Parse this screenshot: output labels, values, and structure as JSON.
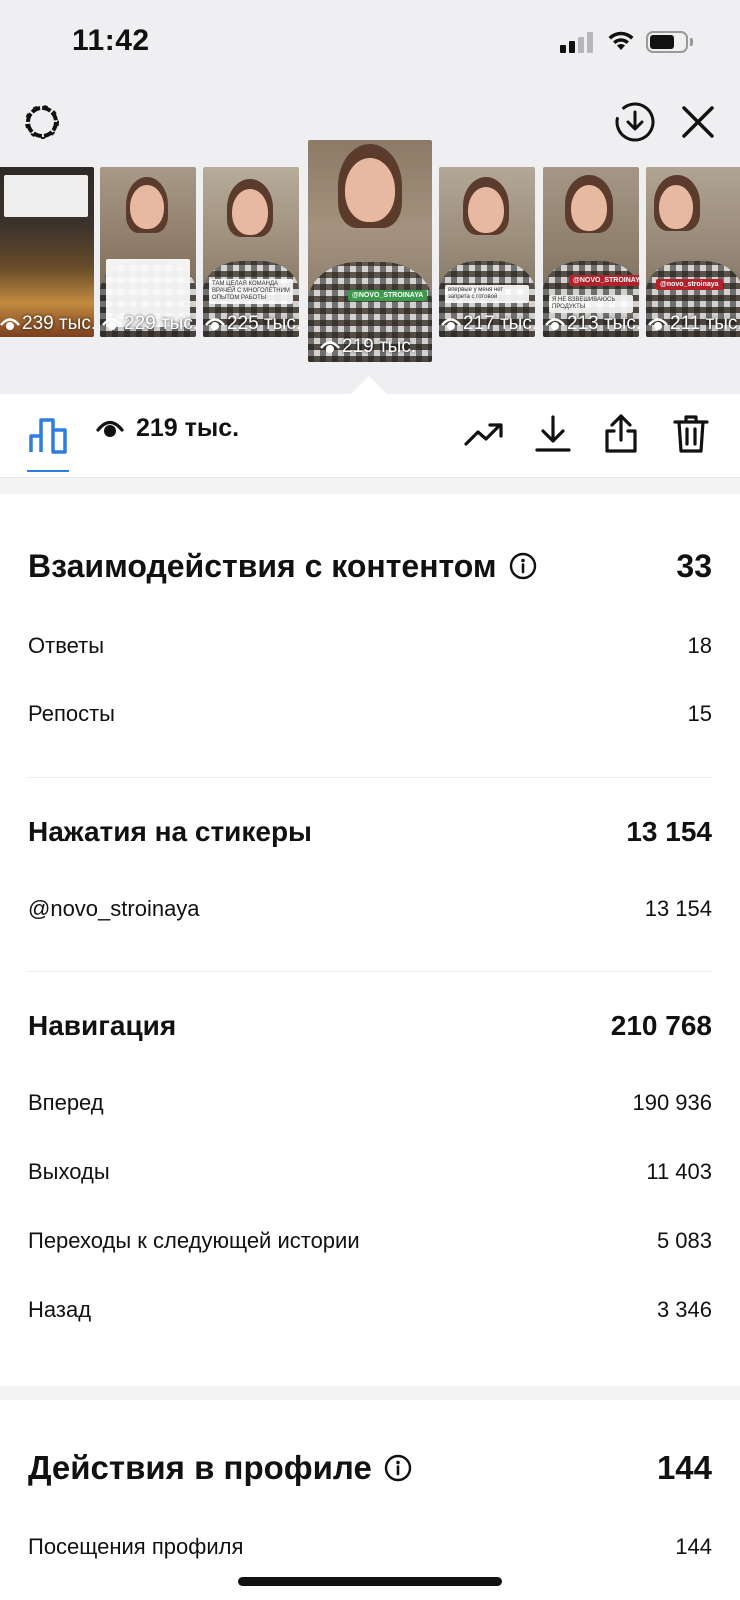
{
  "status_bar": {
    "time": "11:42"
  },
  "thumbnails": [
    {
      "views": "239 тыс.",
      "caption": ""
    },
    {
      "views": "229 тыс.",
      "caption": ""
    },
    {
      "views": "225 тыс.",
      "caption": "ТАМ ЦЕЛАЯ КОМАНДА ВРАЧЕЙ С МНОГОЛЕТНИМ ОПЫТОМ РАБОТЫ"
    },
    {
      "views": "219 тыс.",
      "caption": "",
      "tag": "@NOVO_STROINAYA",
      "active": true
    },
    {
      "views": "217 тыс.",
      "caption": "впервые у меня нет запрета с готовой"
    },
    {
      "views": "213 тыс.",
      "caption": "Я НЕ ВЗВЕШИВАЮСЬ ПРОДУКТЫ",
      "tag": "@NOVO_STROINAYA"
    },
    {
      "views": "211 тыс.",
      "caption": "",
      "tag": "@novo_stroinaya"
    }
  ],
  "toolbar": {
    "views": "219 тыс."
  },
  "sections": {
    "interactions": {
      "title": "Взаимодействия с контентом",
      "total": "33",
      "rows": [
        {
          "label": "Ответы",
          "value": "18"
        },
        {
          "label": "Репосты",
          "value": "15"
        }
      ]
    },
    "stickers": {
      "title": "Нажатия на стикеры",
      "total": "13 154",
      "rows": [
        {
          "label": "@novo_stroinaya",
          "value": "13 154"
        }
      ]
    },
    "navigation": {
      "title": "Навигация",
      "total": "210 768",
      "rows": [
        {
          "label": "Вперед",
          "value": "190 936"
        },
        {
          "label": "Выходы",
          "value": "11 403"
        },
        {
          "label": "Переходы к следующей истории",
          "value": "5 083"
        },
        {
          "label": "Назад",
          "value": "3 346"
        }
      ]
    },
    "profile": {
      "title": "Действия в профиле",
      "total": "144",
      "rows": [
        {
          "label": "Посещения профиля",
          "value": "144"
        }
      ]
    }
  },
  "colors": {
    "accent": "#2f7de1",
    "sticker_green": "#3a9a4a",
    "sticker_red": "#b1222c"
  },
  "icons": [
    "settings-gear-icon",
    "save-download-circle-icon",
    "close-icon",
    "bar-chart-icon",
    "eye-icon",
    "trending-icon",
    "download-icon",
    "share-icon",
    "trash-icon",
    "info-icon"
  ]
}
